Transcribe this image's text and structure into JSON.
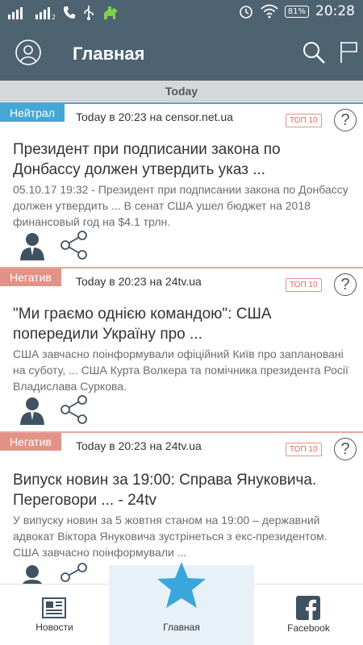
{
  "status_bar": {
    "time": "20:28",
    "battery": "81%"
  },
  "app_bar": {
    "title": "Главная"
  },
  "section": {
    "label": "Today"
  },
  "cards": [
    {
      "tag": "Нейтрал",
      "meta": "Today в 20:23 на censor.net.ua",
      "badge": "ТОП 10",
      "help": "?",
      "headline": "Президент при подписании закона по Донбассу должен утвердить указ ...",
      "snippet": "05.10.17 19:32 - Президент при подписании закона по Донбассу должен утвердить ... В сенат США ушел бюджет на 2018 финансовый год на $4.1 трлн."
    },
    {
      "tag": "Негатив",
      "meta": "Today в 20:23 на 24tv.ua",
      "badge": "ТОП 10",
      "help": "?",
      "headline": "\"Ми граємо однією командою\": США попередили Україну про ...",
      "snippet": "США завчасно поінформували офіційний Київ про заплановані на суботу, ... США Курта Волкера та помічника президента Росії Владислава Суркова."
    },
    {
      "tag": "Негатив",
      "meta": "Today в 20:23 на 24tv.ua",
      "badge": "ТОП 10",
      "help": "?",
      "headline": "Випуск новин за 19:00: Справа Януковича. Переговори ... - 24tv",
      "snippet": "У випуску новин за 5 жовтня станом на 19:00 – державний адвокат Віктора Януковича зустрінеться з екс-президентом. США завчасно поінформували ..."
    }
  ],
  "bottom_nav": {
    "news": "Новости",
    "home": "Главная",
    "facebook": "Facebook"
  },
  "colors": {
    "bar": "#4e6372",
    "neutral": "#45a7d6",
    "negative": "#e39287",
    "accent": "#3aa6dc"
  }
}
